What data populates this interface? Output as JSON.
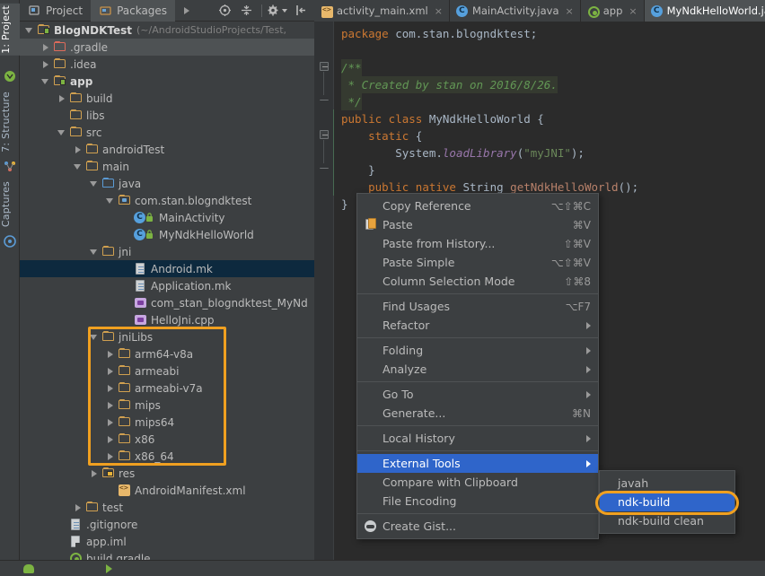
{
  "left_strip": {
    "tabs": [
      {
        "label": "1: Project",
        "icon": "project-icon",
        "selected": true
      },
      {
        "label": "7: Structure",
        "icon": "structure-icon",
        "selected": false
      },
      {
        "label": "Captures",
        "icon": "captures-icon",
        "selected": false
      }
    ]
  },
  "project_toolbar": {
    "tabs": [
      {
        "label": "Project",
        "icon": "project-view-icon",
        "active": true
      },
      {
        "label": "Packages",
        "icon": "packages-icon",
        "active": false
      }
    ],
    "overflow_label": "▶",
    "icons": [
      "target-icon",
      "collapse-all-icon",
      "gear-icon",
      "hide-panel-icon"
    ]
  },
  "tree": {
    "nodes": [
      {
        "id": "root",
        "label": "BlogNDKTest",
        "path": "(~/AndroidStudioProjects/Test,",
        "indent": 0,
        "arrow": "down",
        "icon": "module-folder-icon",
        "bold": true,
        "selected": false
      },
      {
        "id": "gradle",
        "label": ".gradle",
        "indent": 1,
        "arrow": "right",
        "icon": "folder-red-icon",
        "selected": "gray"
      },
      {
        "id": "idea",
        "label": ".idea",
        "indent": 1,
        "arrow": "right",
        "icon": "folder-icon",
        "selected": false
      },
      {
        "id": "app",
        "label": "app",
        "indent": 1,
        "arrow": "down",
        "icon": "module-folder-icon",
        "bold": true,
        "selected": false
      },
      {
        "id": "build",
        "label": "build",
        "indent": 2,
        "arrow": "right",
        "icon": "folder-icon",
        "selected": false
      },
      {
        "id": "libs",
        "label": "libs",
        "indent": 2,
        "arrow": "none",
        "icon": "folder-icon",
        "selected": false
      },
      {
        "id": "src",
        "label": "src",
        "indent": 2,
        "arrow": "down",
        "icon": "folder-icon",
        "selected": false
      },
      {
        "id": "androidTest",
        "label": "androidTest",
        "indent": 3,
        "arrow": "right",
        "icon": "folder-icon",
        "selected": false
      },
      {
        "id": "main",
        "label": "main",
        "indent": 3,
        "arrow": "down",
        "icon": "folder-icon",
        "selected": false
      },
      {
        "id": "java",
        "label": "java",
        "indent": 4,
        "arrow": "down",
        "icon": "folder-blue-icon",
        "selected": false
      },
      {
        "id": "pkg",
        "label": "com.stan.blogndktest",
        "indent": 5,
        "arrow": "down",
        "icon": "package-icon",
        "selected": false
      },
      {
        "id": "MainActivity",
        "label": "MainActivity",
        "indent": 6,
        "arrow": "none",
        "icon": "java-class-icon",
        "selected": false
      },
      {
        "id": "MyNdkHelloWorld",
        "label": "MyNdkHelloWorld",
        "indent": 6,
        "arrow": "none",
        "icon": "java-class-icon",
        "selected": false
      },
      {
        "id": "jni",
        "label": "jni",
        "indent": 4,
        "arrow": "down",
        "icon": "folder-icon",
        "selected": false
      },
      {
        "id": "Android.mk",
        "label": "Android.mk",
        "indent": 6,
        "arrow": "none",
        "icon": "text-file-icon",
        "selected": "blue"
      },
      {
        "id": "Application.mk",
        "label": "Application.mk",
        "indent": 6,
        "arrow": "none",
        "icon": "text-file-icon",
        "selected": false
      },
      {
        "id": "header",
        "label": "com_stan_blogndktest_MyNd",
        "indent": 6,
        "arrow": "none",
        "icon": "cpp-file-icon",
        "selected": false
      },
      {
        "id": "HelloJni.cpp",
        "label": "HelloJni.cpp",
        "indent": 6,
        "arrow": "none",
        "icon": "cpp-file-icon",
        "selected": false
      },
      {
        "id": "jniLibs",
        "label": "jniLibs",
        "indent": 4,
        "arrow": "down",
        "icon": "folder-icon",
        "selected": false
      },
      {
        "id": "arm64-v8a",
        "label": "arm64-v8a",
        "indent": 5,
        "arrow": "right",
        "icon": "folder-icon",
        "selected": false
      },
      {
        "id": "armeabi",
        "label": "armeabi",
        "indent": 5,
        "arrow": "right",
        "icon": "folder-icon",
        "selected": false
      },
      {
        "id": "armeabi-v7a",
        "label": "armeabi-v7a",
        "indent": 5,
        "arrow": "right",
        "icon": "folder-icon",
        "selected": false
      },
      {
        "id": "mips",
        "label": "mips",
        "indent": 5,
        "arrow": "right",
        "icon": "folder-icon",
        "selected": false
      },
      {
        "id": "mips64",
        "label": "mips64",
        "indent": 5,
        "arrow": "right",
        "icon": "folder-icon",
        "selected": false
      },
      {
        "id": "x86",
        "label": "x86",
        "indent": 5,
        "arrow": "right",
        "icon": "folder-icon",
        "selected": false
      },
      {
        "id": "x86_64",
        "label": "x86_64",
        "indent": 5,
        "arrow": "right",
        "icon": "folder-icon",
        "selected": false
      },
      {
        "id": "res",
        "label": "res",
        "indent": 4,
        "arrow": "right",
        "icon": "res-folder-icon",
        "selected": false
      },
      {
        "id": "AndroidManifest.xml",
        "label": "AndroidManifest.xml",
        "indent": 5,
        "arrow": "none",
        "icon": "xml-file-icon",
        "selected": false
      },
      {
        "id": "test",
        "label": "test",
        "indent": 3,
        "arrow": "right",
        "icon": "folder-icon",
        "selected": false
      },
      {
        "id": ".gitignore",
        "label": ".gitignore",
        "indent": 2,
        "arrow": "none",
        "icon": "text-file-icon",
        "selected": false
      },
      {
        "id": "app.iml",
        "label": "app.iml",
        "indent": 2,
        "arrow": "none",
        "icon": "iml-file-icon",
        "selected": false
      },
      {
        "id": "build.gradle",
        "label": "build.gradle",
        "indent": 2,
        "arrow": "none",
        "icon": "gradle-file-icon",
        "selected": false
      }
    ],
    "highlight_note": "orange box around jniLibs subtree"
  },
  "editor": {
    "tabs": [
      {
        "label": "activity_main.xml",
        "icon": "xml-file-icon",
        "active": false,
        "close": "×"
      },
      {
        "label": "MainActivity.java",
        "icon": "java-class-icon",
        "active": false,
        "close": "×"
      },
      {
        "label": "app",
        "icon": "gradle-file-icon",
        "active": false,
        "close": "×"
      },
      {
        "label": "MyNdkHelloWorld.java",
        "icon": "java-class-icon",
        "active": true,
        "close": "×"
      }
    ],
    "code_lines": [
      "package com.stan.blogndktest;",
      "",
      "/**",
      " * Created by stan on 2016/8/26.",
      " */",
      "public class MyNdkHelloWorld {",
      "    static {",
      "        System.loadLibrary(\"myJNI\");",
      "    }",
      "    public native String getNdkHelloWorld();",
      "}"
    ]
  },
  "context_menu": {
    "items": [
      {
        "label": "Copy Reference",
        "shortcut": "⌥⇧⌘C",
        "icon": "",
        "submenu": false,
        "highlighted": false
      },
      {
        "label": "Paste",
        "shortcut": "⌘V",
        "icon": "paste-icon",
        "submenu": false,
        "highlighted": false
      },
      {
        "label": "Paste from History...",
        "shortcut": "⇧⌘V",
        "icon": "",
        "submenu": false,
        "highlighted": false
      },
      {
        "label": "Paste Simple",
        "shortcut": "⌥⇧⌘V",
        "icon": "",
        "submenu": false,
        "highlighted": false
      },
      {
        "label": "Column Selection Mode",
        "shortcut": "⇧⌘8",
        "icon": "",
        "submenu": false,
        "highlighted": false
      },
      {
        "separator": true
      },
      {
        "label": "Find Usages",
        "shortcut": "⌥F7",
        "icon": "",
        "submenu": false,
        "highlighted": false
      },
      {
        "label": "Refactor",
        "shortcut": "",
        "icon": "",
        "submenu": true,
        "highlighted": false
      },
      {
        "separator": true
      },
      {
        "label": "Folding",
        "shortcut": "",
        "icon": "",
        "submenu": true,
        "highlighted": false
      },
      {
        "label": "Analyze",
        "shortcut": "",
        "icon": "",
        "submenu": true,
        "highlighted": false
      },
      {
        "separator": true
      },
      {
        "label": "Go To",
        "shortcut": "",
        "icon": "",
        "submenu": true,
        "highlighted": false
      },
      {
        "label": "Generate...",
        "shortcut": "⌘N",
        "icon": "",
        "submenu": false,
        "highlighted": false
      },
      {
        "separator": true
      },
      {
        "label": "Local History",
        "shortcut": "",
        "icon": "",
        "submenu": true,
        "highlighted": false
      },
      {
        "separator": true
      },
      {
        "label": "External Tools",
        "shortcut": "",
        "icon": "",
        "submenu": true,
        "highlighted": true
      },
      {
        "label": "Compare with Clipboard",
        "shortcut": "",
        "icon": "",
        "submenu": false,
        "highlighted": false
      },
      {
        "label": "File Encoding",
        "shortcut": "",
        "icon": "",
        "submenu": false,
        "highlighted": false
      },
      {
        "separator": true
      },
      {
        "label": "Create Gist...",
        "shortcut": "",
        "icon": "gist-icon",
        "submenu": false,
        "highlighted": false
      }
    ]
  },
  "submenu": {
    "items": [
      {
        "label": "javah",
        "highlighted": false
      },
      {
        "label": "ndk-build",
        "highlighted": true
      },
      {
        "label": "ndk-build clean",
        "highlighted": false
      }
    ],
    "annotation": "orange ellipse around ndk-build"
  },
  "colors": {
    "accent_highlight": "#f0a020",
    "menu_selection": "#2f65ca",
    "tree_selection": "#0d293e",
    "panel_bg": "#3c3f41",
    "editor_bg": "#2b2b2b"
  }
}
